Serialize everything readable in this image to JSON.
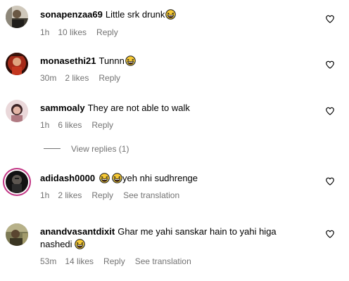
{
  "comments": [
    {
      "username": "sonapenzaa69",
      "text": "Little srk drunk",
      "emoji_after": "laughing-emoji",
      "time": "1h",
      "likes": "10 likes",
      "reply": "Reply",
      "avatar_colors": [
        "#d7d0c4",
        "#40382e"
      ]
    },
    {
      "username": "monasethi21",
      "text": "Tunnn",
      "emoji_after": "laughing-emoji",
      "time": "30m",
      "likes": "2 likes",
      "reply": "Reply",
      "avatar_colors": [
        "#b7311f",
        "#2a0c07"
      ]
    },
    {
      "username": "sammoaly",
      "text": "They are not able to walk",
      "time": "1h",
      "likes": "6 likes",
      "reply": "Reply",
      "avatar_colors": [
        "#e8cfd2",
        "#8a5a61"
      ],
      "view_replies": "View replies (1)"
    },
    {
      "username": "adidash0000",
      "text": "yeh nhi sudhrenge",
      "emoji_before": [
        "laughing-emoji",
        "laughing-emoji"
      ],
      "time": "1h",
      "likes": "2 likes",
      "reply": "Reply",
      "see_translation": "See translation",
      "avatar_colors": [
        "#545454",
        "#0f0f0f"
      ],
      "story_ring": true
    },
    {
      "username": "anandvasantdixit",
      "text_line1": "Ghar me yahi sanskar hain to yahi higa",
      "text_line2": "nashedi",
      "emoji_after": "laughing-emoji",
      "time": "53m",
      "likes": "14 likes",
      "reply": "Reply",
      "see_translation": "See translation",
      "avatar_colors": [
        "#8a8150",
        "#3a3520"
      ]
    }
  ],
  "colors": {
    "meta_text": "#737373",
    "story_ring": "#c13584",
    "emoji_face": "#f7c934",
    "emoji_outline": "#1a1a1a"
  }
}
